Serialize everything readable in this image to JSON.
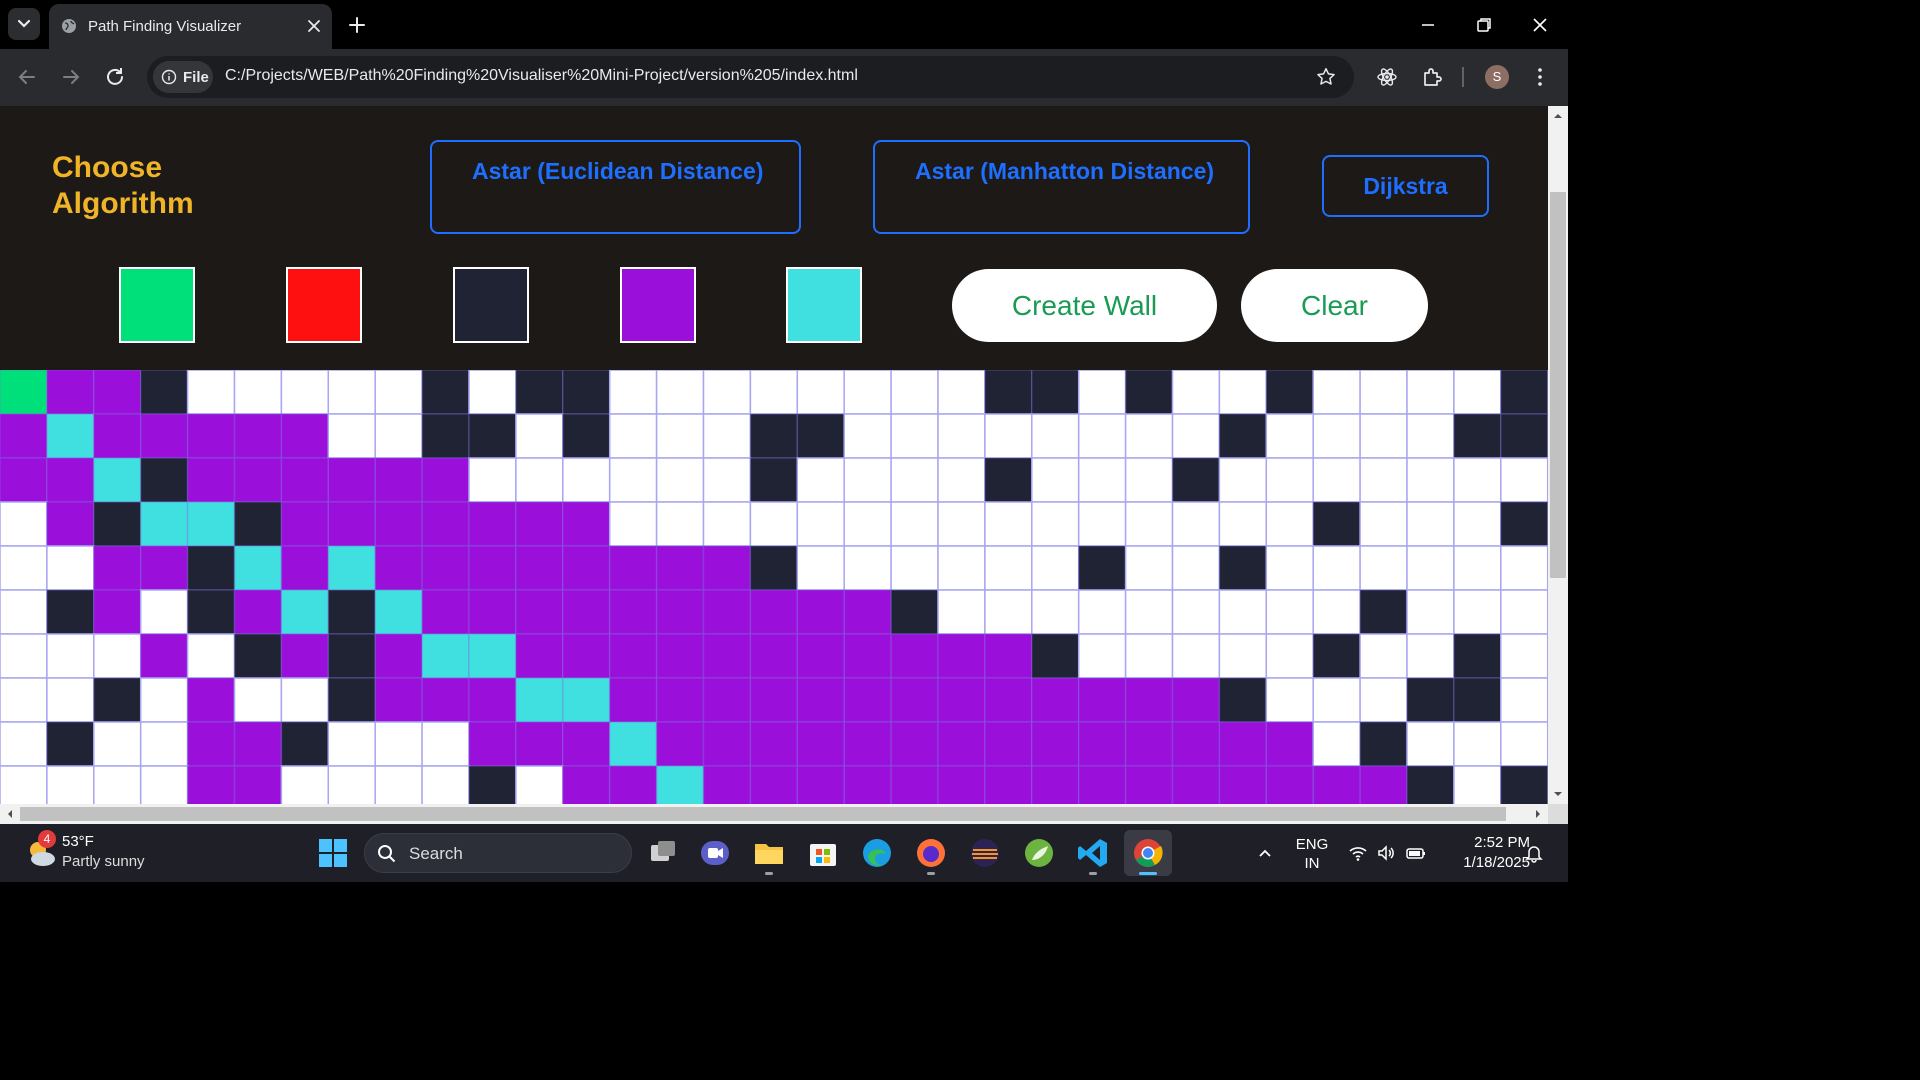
{
  "browser": {
    "tab_title": "Path Finding Visualizer",
    "file_chip": "File",
    "url": "C:/Projects/WEB/Path%20Finding%20Visualiser%20Mini-Project/version%205/index.html",
    "avatar_letter": "S"
  },
  "header": {
    "choose_title": "Choose Algorithm",
    "algorithms": [
      "Astar (Euclidean Distance)",
      "Astar (Manhatton Distance)",
      "Dijkstra"
    ],
    "swatches": [
      "#00e07a",
      "#ff1010",
      "#1f2333",
      "#9b0fdb",
      "#40e0e0"
    ],
    "create_wall_label": "Create Wall",
    "clear_label": "Clear"
  },
  "grid": {
    "legend": {
      "W": "#ffffff",
      "K": "#1f2333",
      "P": "#9b0fdb",
      "C": "#40e0e0",
      "G": "#00e07a"
    },
    "rows": [
      "GPPKWWWWWKWKKWWWWWWWWKKWKWWKWWWWK",
      "PCPPPPPWWKKWKWWWKKWWWWWWWWKWWWWKK",
      "PPCKPPPPPPWWWWWWKWWWWKWWWKWWWWWWW",
      "WPKCCKPPPPPPPWWWWWWWWWWWWWWWKWWWK",
      "WWPPKCPCPPPPPPPPKWWWWWWKWWKWWWWWW",
      "WKPWKPCKCPPPPPPPPPPKWWWWWWWWWKWWW",
      "WWWPWKPKPCCPPPPPPPPPPPKWWWWWKWWKW",
      "WWKWPWWKPPPCCPPPPPPPPPPPPPKWWWKKW",
      "WKWWPPKWWWPPPCPPPPPPPPPPPPPPWKWWW",
      "WWWWPPWWWWKWPPCPPPPPPPPPPPPPPPKWK"
    ]
  },
  "taskbar": {
    "weather_badge": "4",
    "weather_temp": "53°F",
    "weather_desc": "Partly sunny",
    "search_label": "Search",
    "lang_top": "ENG",
    "lang_bottom": "IN",
    "time": "2:52 PM",
    "date": "1/18/2025"
  }
}
